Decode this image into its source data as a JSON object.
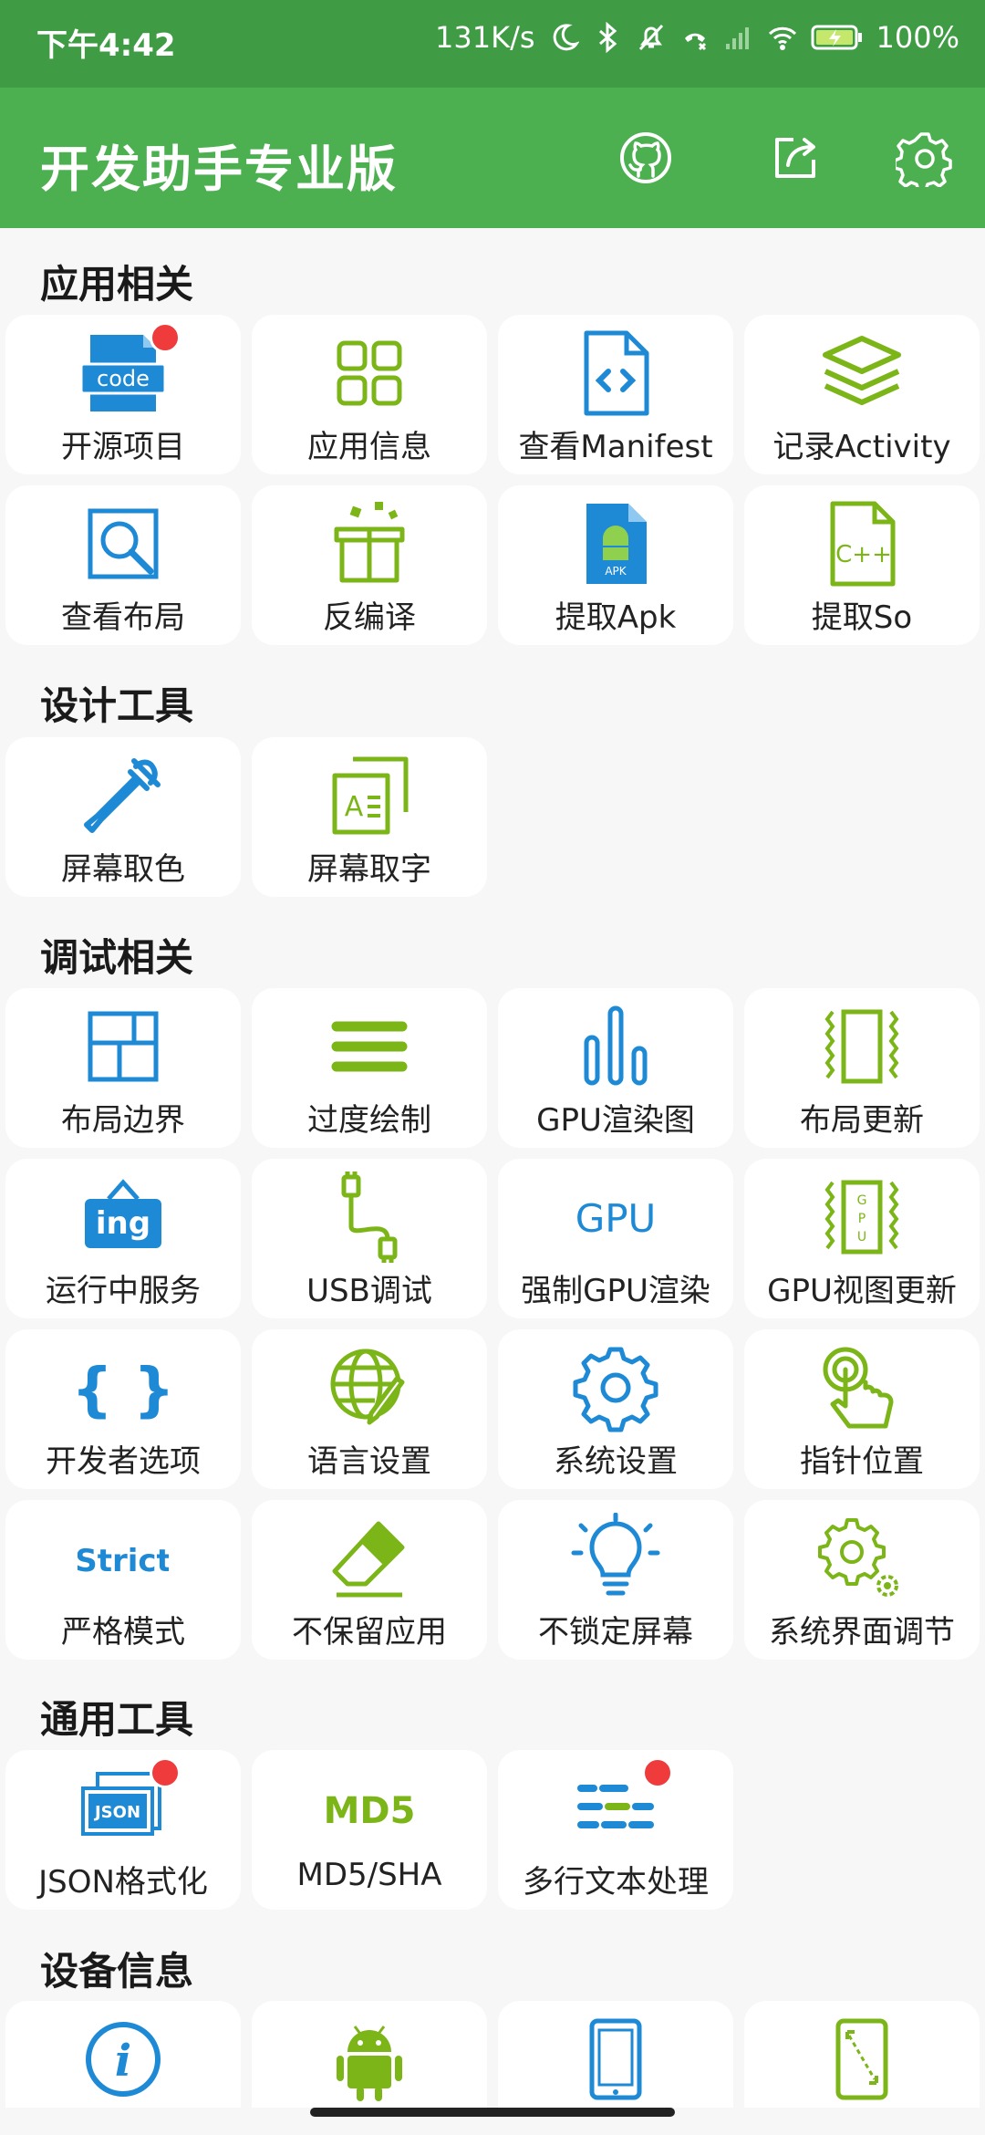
{
  "status_bar": {
    "time": "下午4:42",
    "speed": "131K/s",
    "battery": "100%"
  },
  "app_bar": {
    "title": "开发助手专业版",
    "icons": [
      "github-icon",
      "share-icon",
      "gear-icon"
    ]
  },
  "colors": {
    "green": "#4caf50",
    "dark_green": "#3f9b44",
    "blue": "#1e8ad6",
    "lime": "#7cb518",
    "badge": "#ef3b3b"
  },
  "sections": [
    {
      "title": "应用相关",
      "items": [
        {
          "label": "开源项目",
          "icon": "code-icon"
        },
        {
          "label": "应用信息",
          "icon": "grid-icon"
        },
        {
          "label": "查看Manifest",
          "icon": "file-code-icon"
        },
        {
          "label": "记录Activity",
          "icon": "layers-icon"
        },
        {
          "label": "查看布局",
          "icon": "layout-search-icon"
        },
        {
          "label": "反编译",
          "icon": "box-icon"
        },
        {
          "label": "提取Apk",
          "icon": "apk-icon"
        },
        {
          "label": "提取So",
          "icon": "cpp-file-icon"
        }
      ]
    },
    {
      "title": "设计工具",
      "items": [
        {
          "label": "屏幕取色",
          "icon": "eyedropper-icon"
        },
        {
          "label": "屏幕取字",
          "icon": "text-capture-icon"
        }
      ]
    },
    {
      "title": "调试相关",
      "items": [
        {
          "label": "布局边界",
          "icon": "layout-bounds-icon"
        },
        {
          "label": "过度绘制",
          "icon": "overdraw-icon"
        },
        {
          "label": "GPU渲染图",
          "icon": "bar-graph-icon"
        },
        {
          "label": "布局更新",
          "icon": "layout-update-icon"
        },
        {
          "label": "运行中服务",
          "icon": "ing-sign-icon",
          "text": "ing"
        },
        {
          "label": "USB调试",
          "icon": "usb-icon"
        },
        {
          "label": "强制GPU渲染",
          "icon": "gpu-text-icon",
          "text": "GPU"
        },
        {
          "label": "GPU视图更新",
          "icon": "gpu-update-icon",
          "text": "GPU"
        },
        {
          "label": "开发者选项",
          "icon": "braces-icon",
          "text": "{ }"
        },
        {
          "label": "语言设置",
          "icon": "globe-pen-icon"
        },
        {
          "label": "系统设置",
          "icon": "settings-gear-icon"
        },
        {
          "label": "指针位置",
          "icon": "pointer-touch-icon"
        },
        {
          "label": "严格模式",
          "icon": "strict-text-icon",
          "text": "Strict"
        },
        {
          "label": "不保留应用",
          "icon": "eraser-icon"
        },
        {
          "label": "不锁定屏幕",
          "icon": "bulb-icon"
        },
        {
          "label": "系统界面调节",
          "icon": "gears-icon"
        }
      ]
    },
    {
      "title": "通用工具",
      "items": [
        {
          "label": "JSON格式化",
          "icon": "json-icon",
          "text": "JSON"
        },
        {
          "label": "MD5/SHA",
          "icon": "md5-text-icon",
          "text": "MD5"
        },
        {
          "label": "多行文本处理",
          "icon": "multiline-icon"
        }
      ]
    },
    {
      "title": "设备信息",
      "items": [
        {
          "label": "",
          "icon": "info-icon"
        },
        {
          "label": "",
          "icon": "android-icon"
        },
        {
          "label": "",
          "icon": "phone-icon"
        },
        {
          "label": "",
          "icon": "screen-size-icon"
        }
      ]
    }
  ]
}
